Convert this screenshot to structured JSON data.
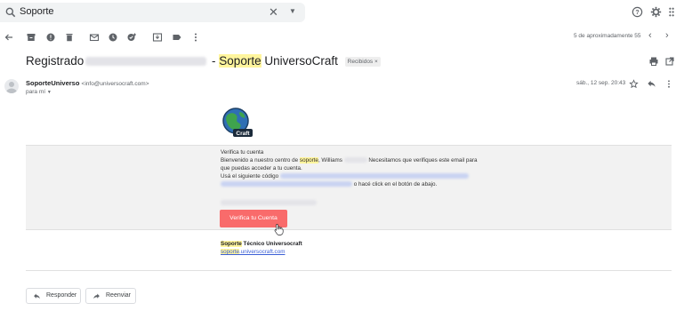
{
  "search": {
    "query": "Soporte"
  },
  "toolbar": {
    "pager_text": "5 de aproximadamente 55"
  },
  "email": {
    "subject_prefix": "Registrado",
    "subject_sep": " - ",
    "subject_hl": "Soporte",
    "subject_rest": " UniversoCraft",
    "label_badge": "Recibidos ×",
    "sender_name": "SoporteUniverso",
    "sender_email": "<info@universocraft.com>",
    "to_me": "para mí",
    "date": "sáb., 12 sep. 20:43"
  },
  "body": {
    "heading": "Verifica tu cuenta",
    "line1_a": "Bienvenido a nuestro centro de ",
    "line1_hl": "soporte",
    "line1_b": ", Williams",
    "line1_c": " Necesitamos que verifiques este email para",
    "line2": "que puedas acceder a tu cuenta.",
    "line3_a": "Usá el siguiente código ",
    "line4_b": " o hacé click en el botón de abajo.",
    "cta_label": "Verifica tu Cuenta",
    "sig_hl": "Soporte",
    "sig_rest": " Técnico Universocraft",
    "sig_link_hl": "soporte",
    "sig_link_rest": ".universocraft.com"
  },
  "actions": {
    "reply_label": "Responder",
    "forward_label": "Reenviar"
  },
  "colors": {
    "cta": "#f96b6b",
    "highlight": "#fff59d",
    "link": "#3b5fd6"
  }
}
